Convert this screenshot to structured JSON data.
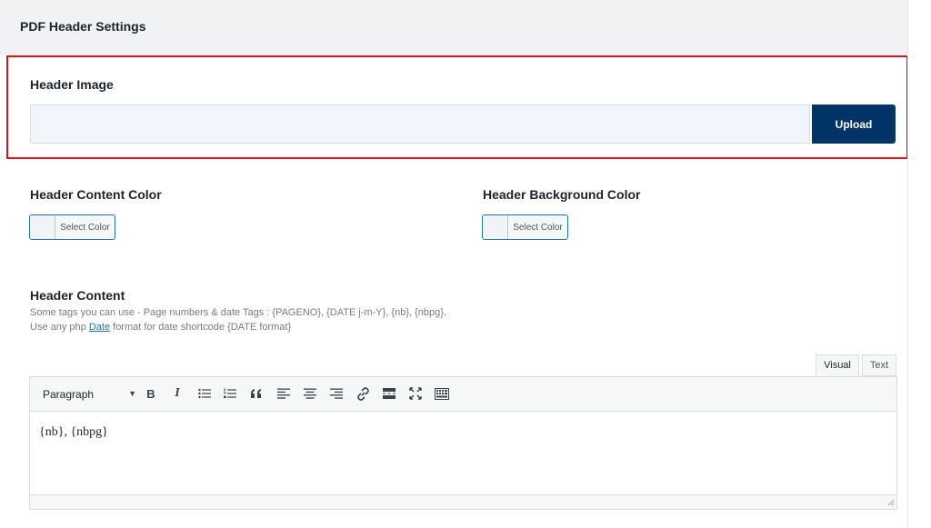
{
  "section": {
    "title": "PDF Header Settings"
  },
  "header_image": {
    "label": "Header Image",
    "value": "",
    "upload_label": "Upload"
  },
  "content_color": {
    "label": "Header Content Color",
    "button_label": "Select Color"
  },
  "background_color": {
    "label": "Header Background Color",
    "button_label": "Select Color"
  },
  "header_content": {
    "label": "Header Content",
    "desc_line1": "Some tags you can use - Page numbers & date Tags : {PAGENO}, {DATE j-m-Y}, {nb}, {nbpg}.",
    "desc_line2_prefix": "Use any php ",
    "desc_line2_link": "Date",
    "desc_line2_suffix": " format for date shortcode {DATE format}"
  },
  "editor": {
    "tabs": [
      "Visual",
      "Text"
    ],
    "format_value": "Paragraph",
    "toolbar_icons": [
      "bold-icon",
      "italic-icon",
      "bullet-list-icon",
      "numbered-list-icon",
      "blockquote-icon",
      "align-left-icon",
      "align-center-icon",
      "align-right-icon",
      "link-icon",
      "read-more-icon",
      "fullscreen-icon",
      "toolbar-toggle-icon"
    ],
    "bold_glyph": "B",
    "italic_glyph": "I",
    "content": "{nb}, {nbpg}"
  }
}
